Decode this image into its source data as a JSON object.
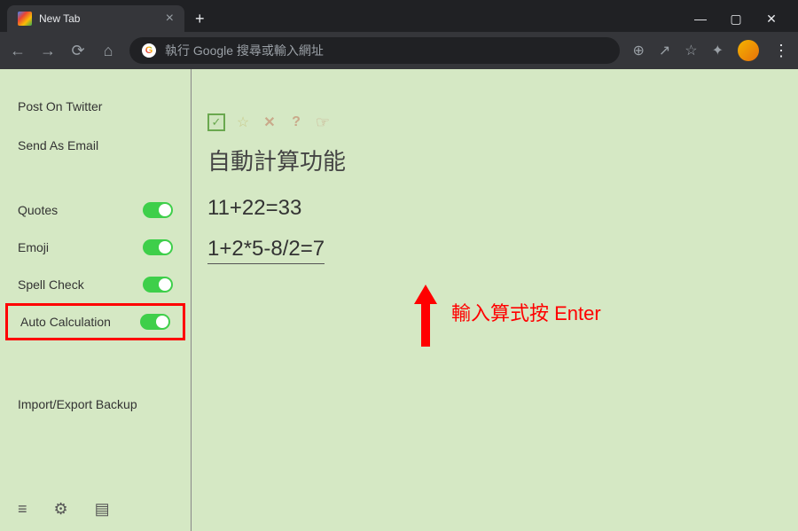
{
  "browser": {
    "tab_title": "New Tab",
    "address_placeholder": "執行 Google 搜尋或輸入網址"
  },
  "sidebar": {
    "actions": [
      {
        "label": "Post On Twitter"
      },
      {
        "label": "Send As Email"
      }
    ],
    "toggles": [
      {
        "label": "Quotes",
        "on": true
      },
      {
        "label": "Emoji",
        "on": true
      },
      {
        "label": "Spell Check",
        "on": true
      },
      {
        "label": "Auto Calculation",
        "on": true,
        "highlighted": true
      }
    ],
    "backup": "Import/Export Backup"
  },
  "content": {
    "title": "自動計算功能",
    "equation1": "11+22=33",
    "equation2": "1+2*5-8/2=7",
    "annotation": "輸入算式按 Enter"
  }
}
